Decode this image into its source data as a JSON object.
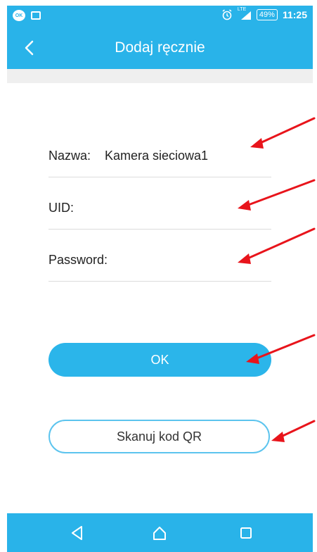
{
  "status_bar": {
    "left_icons": [
      "signal-badge-icon",
      "image-icon"
    ],
    "badge_text": "OK",
    "network": "LTE",
    "battery": "49%",
    "time": "11:25"
  },
  "header": {
    "back_icon": "chevron-left-icon",
    "title": "Dodaj ręcznie"
  },
  "form": {
    "name": {
      "label": "Nazwa:",
      "value": "Kamera sieciowa1"
    },
    "uid": {
      "label": "UID:",
      "value": ""
    },
    "password": {
      "label": "Password:",
      "value": ""
    }
  },
  "buttons": {
    "ok": "OK",
    "scan_qr": "Skanuj kod QR"
  },
  "colors": {
    "primary": "#29b3e9",
    "annotation_arrow": "#e8141b",
    "divider": "#dcdcdc"
  },
  "nav_bar": {
    "icons": [
      "back-triangle-icon",
      "home-icon",
      "recents-icon"
    ]
  }
}
